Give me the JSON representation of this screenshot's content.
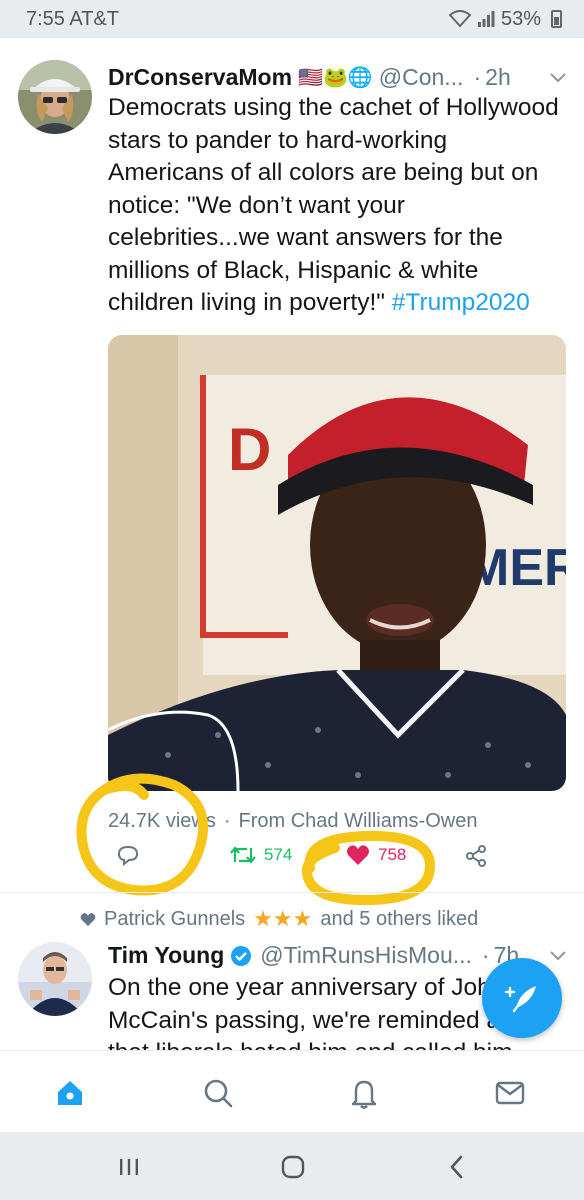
{
  "status_bar": {
    "time": "7:55",
    "carrier": "AT&T",
    "signal_icons": "wifi-icon signal-icon",
    "battery": "53%"
  },
  "tweets": [
    {
      "display_name": "DrConservaMom",
      "badges": "🇺🇸🐸🌐",
      "handle": "@Con...",
      "dot": "·",
      "time": "2h",
      "text_lines": [
        "Democrats using the cachet of Hollywood",
        "stars to pander to hard-working",
        "Americans of all colors are being but on",
        "notice: \"We don’t want your",
        "celebrities...we want answers for the",
        "millions of Black, Hispanic & white",
        "children living in poverty!\""
      ],
      "hashtag": "#Trump2020",
      "media": {
        "sign_text_1": "D",
        "sign_text_2": "MER"
      },
      "views": "24.7K views",
      "from_text": "From Chad Williams-Owen",
      "sep": "·",
      "actions": {
        "reply_count": "",
        "retweet_count": "574",
        "like_count": "758"
      }
    },
    {
      "display_name": "Tim Young",
      "handle": "@TimRunsHisMou...",
      "dot": "·",
      "time": "7h",
      "text_lines": [
        "On the one year anniversary of John",
        "McCain's passing, we're reminded again",
        "that liberals hated him and called him"
      ]
    }
  ],
  "social_context": {
    "name": "Patrick Gunnels",
    "stars": "★★★",
    "rest": "and 5 others liked"
  },
  "colors": {
    "accent": "#1da1f2",
    "retweet": "#17bf63",
    "like": "#e0245e",
    "highlight": "#f5c518",
    "muted": "#657786"
  },
  "tab_bar": [
    "home-icon",
    "search-icon",
    "notifications-icon",
    "messages-icon"
  ],
  "nav_bar": [
    "recent-apps-icon",
    "home-button-icon",
    "back-icon"
  ]
}
